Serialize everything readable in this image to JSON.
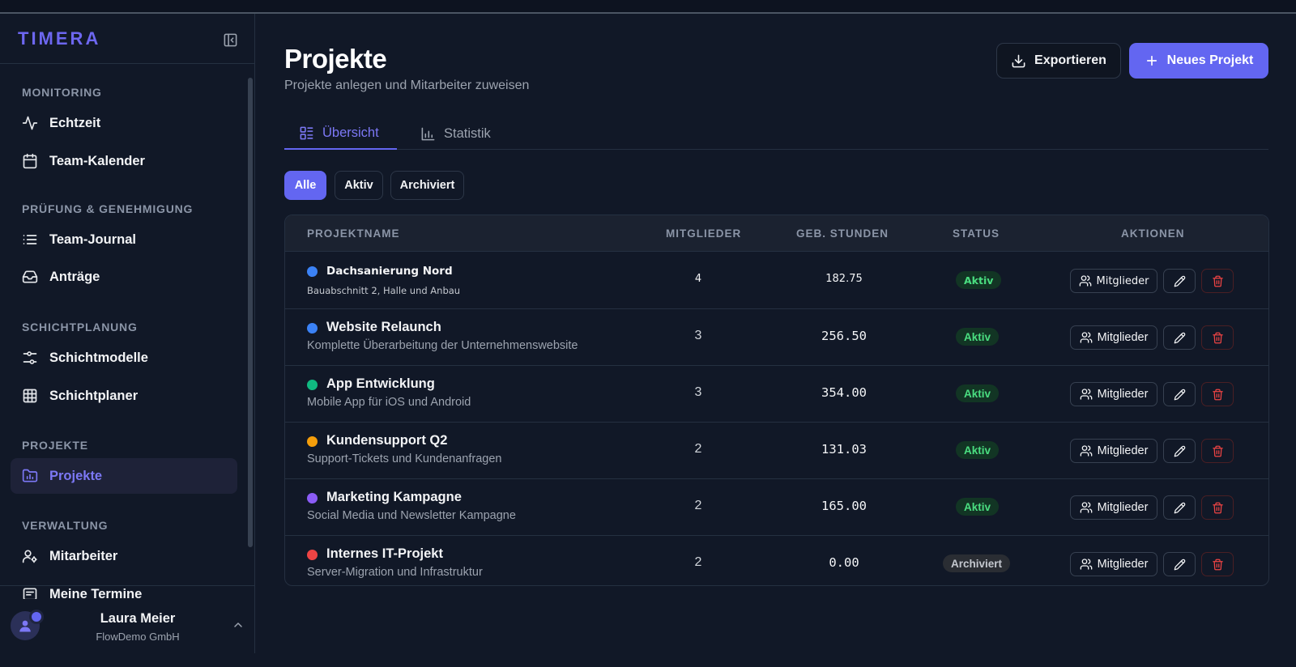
{
  "app": {
    "brand": "TIMERA"
  },
  "sidebar": {
    "sections": [
      {
        "label": "MONITORING",
        "items": [
          {
            "label": "Echtzeit",
            "icon": "activity-icon"
          },
          {
            "label": "Team-Kalender",
            "icon": "calendar-icon"
          }
        ]
      },
      {
        "label": "PRÜFUNG & GENEHMIGUNG",
        "items": [
          {
            "label": "Team-Journal",
            "icon": "list-icon"
          },
          {
            "label": "Anträge",
            "icon": "inbox-icon"
          }
        ]
      },
      {
        "label": "SCHICHTPLANUNG",
        "items": [
          {
            "label": "Schichtmodelle",
            "icon": "sliders-icon"
          },
          {
            "label": "Schichtplaner",
            "icon": "grid-icon"
          }
        ]
      },
      {
        "label": "PROJEKTE",
        "items": [
          {
            "label": "Projekte",
            "icon": "folder-chart-icon",
            "active": true
          }
        ]
      },
      {
        "label": "VERWALTUNG",
        "items": [
          {
            "label": "Mitarbeiter",
            "icon": "user-cog-icon"
          },
          {
            "label": "Meine Termine",
            "icon": "list-box-icon"
          }
        ]
      }
    ],
    "user": {
      "name": "Laura Meier",
      "company": "FlowDemo GmbH"
    }
  },
  "header": {
    "title": "Projekte",
    "subtitle": "Projekte anlegen und Mitarbeiter zuweisen",
    "export_label": "Exportieren",
    "new_label": "Neues Projekt"
  },
  "tabs": [
    {
      "label": "Übersicht",
      "active": true
    },
    {
      "label": "Statistik",
      "active": false
    }
  ],
  "filters": [
    {
      "label": "Alle",
      "active": true
    },
    {
      "label": "Aktiv",
      "active": false
    },
    {
      "label": "Archiviert",
      "active": false
    }
  ],
  "table": {
    "columns": [
      "PROJEKTNAME",
      "MITGLIEDER",
      "GEB. STUNDEN",
      "STATUS",
      "AKTIONEN"
    ],
    "members_label": "Mitglieder",
    "rows": [
      {
        "name": "Dachsanierung Nord",
        "desc": "Bauabschnitt 2, Halle und Anbau",
        "color": "#3b82f6",
        "members": "4",
        "hours": "182.75",
        "status": "Aktiv"
      },
      {
        "name": "Website Relaunch",
        "desc": "Komplette Überarbeitung der Unternehmenswebsite",
        "color": "#3b82f6",
        "members": "3",
        "hours": "256.50",
        "status": "Aktiv"
      },
      {
        "name": "App Entwicklung",
        "desc": "Mobile App für iOS und Android",
        "color": "#10b981",
        "members": "3",
        "hours": "354.00",
        "status": "Aktiv"
      },
      {
        "name": "Kundensupport Q2",
        "desc": "Support-Tickets und Kundenanfragen",
        "color": "#f59e0b",
        "members": "2",
        "hours": "131.03",
        "status": "Aktiv"
      },
      {
        "name": "Marketing Kampagne",
        "desc": "Social Media und Newsletter Kampagne",
        "color": "#8b5cf6",
        "members": "2",
        "hours": "165.00",
        "status": "Aktiv"
      },
      {
        "name": "Internes IT-Projekt",
        "desc": "Server-Migration und Infrastruktur",
        "color": "#ef4444",
        "members": "2",
        "hours": "0.00",
        "status": "Archiviert"
      }
    ]
  },
  "colors": {
    "accent": "#6366f1",
    "active_badge": "#4ade80",
    "danger": "#ef4444"
  }
}
